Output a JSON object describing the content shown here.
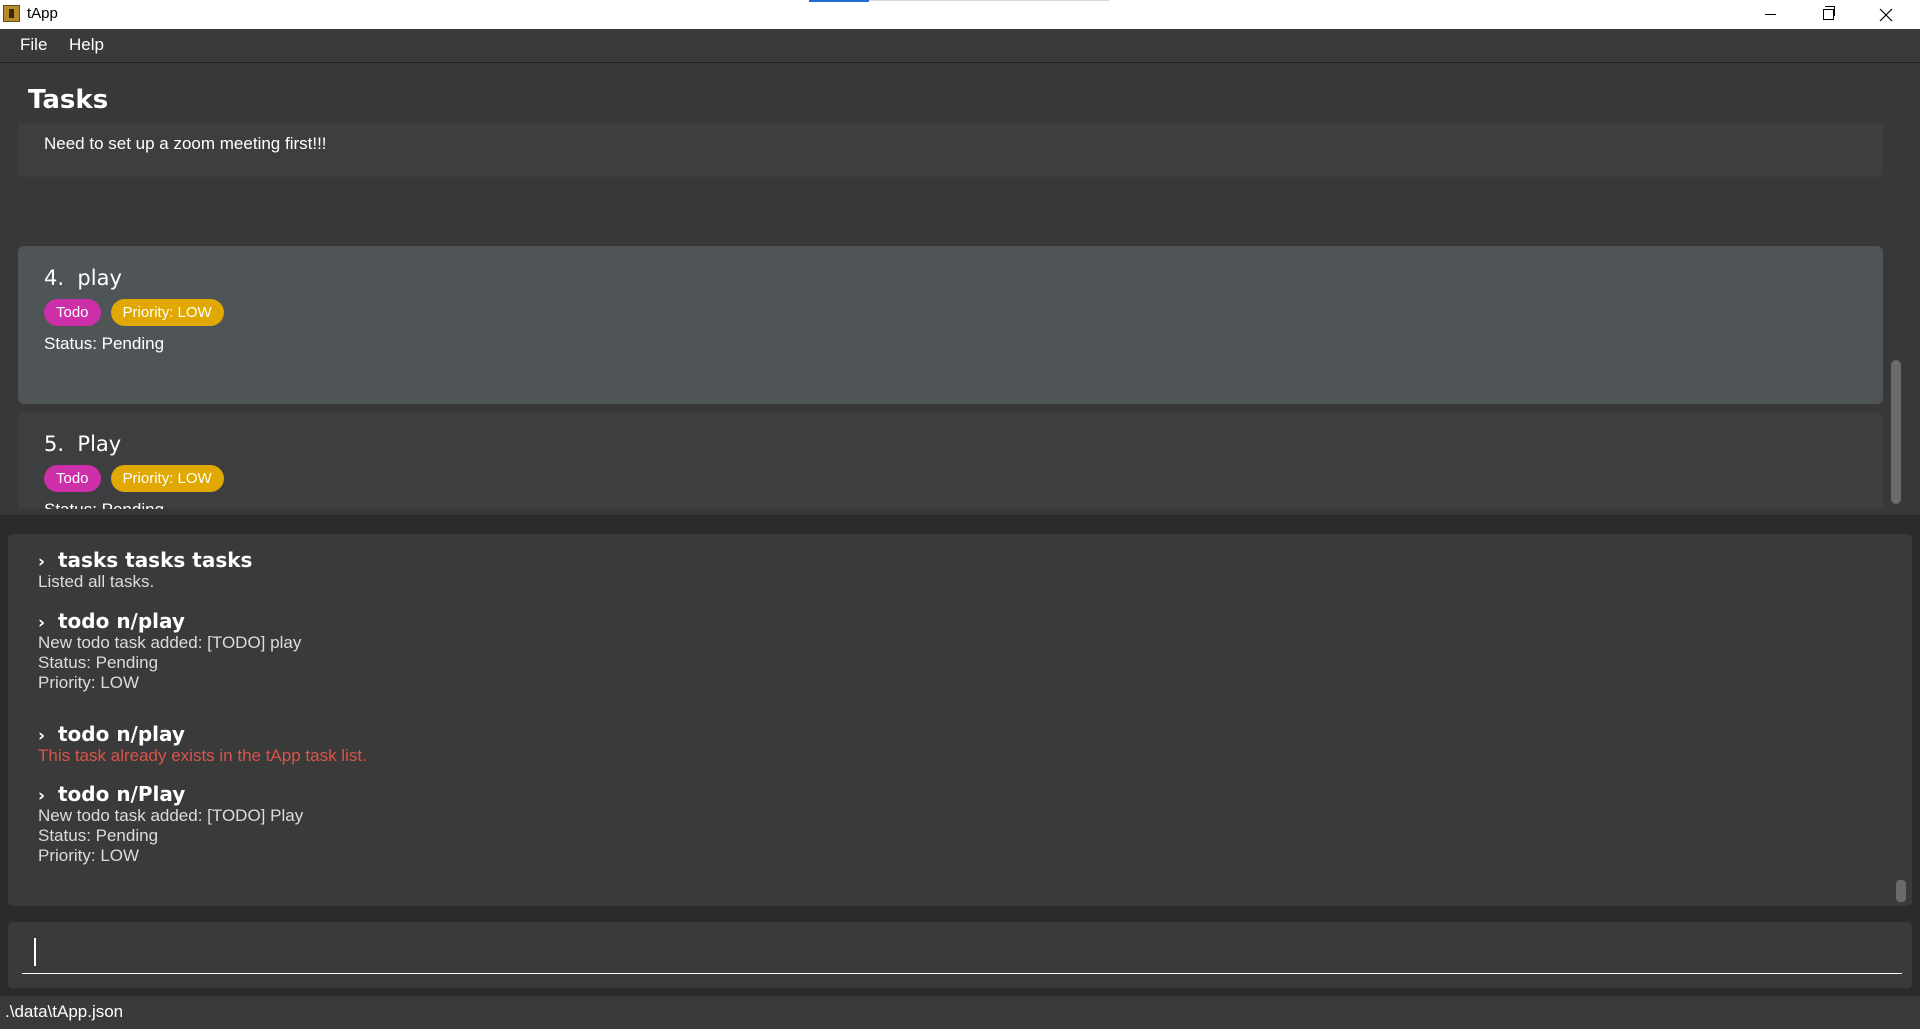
{
  "window": {
    "title": "tApp"
  },
  "menu": {
    "file": "File",
    "help": "Help"
  },
  "tasks": {
    "title": "Tasks",
    "partial_card": {
      "description": "Need to set up a zoom meeting first!!!"
    },
    "cards": [
      {
        "index": "4.",
        "name": "play",
        "tags": [
          "Todo",
          "Priority: LOW"
        ],
        "status": "Status: Pending",
        "selected": true
      },
      {
        "index": "5.",
        "name": "Play",
        "tags": [
          "Todo",
          "Priority: LOW"
        ],
        "status": "Status: Pending",
        "selected": false
      }
    ]
  },
  "result_log": [
    {
      "command": "tasks tasks tasks",
      "lines": [
        "Listed all tasks."
      ],
      "error": false
    },
    {
      "command": "todo n/play",
      "lines": [
        "New todo task added: [TODO] play",
        "Status: Pending",
        "Priority: LOW"
      ],
      "error": false
    },
    {
      "command": "todo n/play",
      "lines": [
        "This task already exists in the tApp task list."
      ],
      "error": true
    },
    {
      "command": "todo n/Play",
      "lines": [
        "New todo task added: [TODO] Play",
        "Status: Pending",
        "Priority: LOW"
      ],
      "error": false
    }
  ],
  "command_box": {
    "value": "",
    "placeholder": ""
  },
  "status_bar": {
    "path": ".\\data\\tApp.json"
  },
  "colors": {
    "todo_tag": "#cc2fa8",
    "priority_tag": "#e0a800",
    "error_text": "#d9544a",
    "selected_card": "#4f5457",
    "card": "#3c3e40"
  }
}
